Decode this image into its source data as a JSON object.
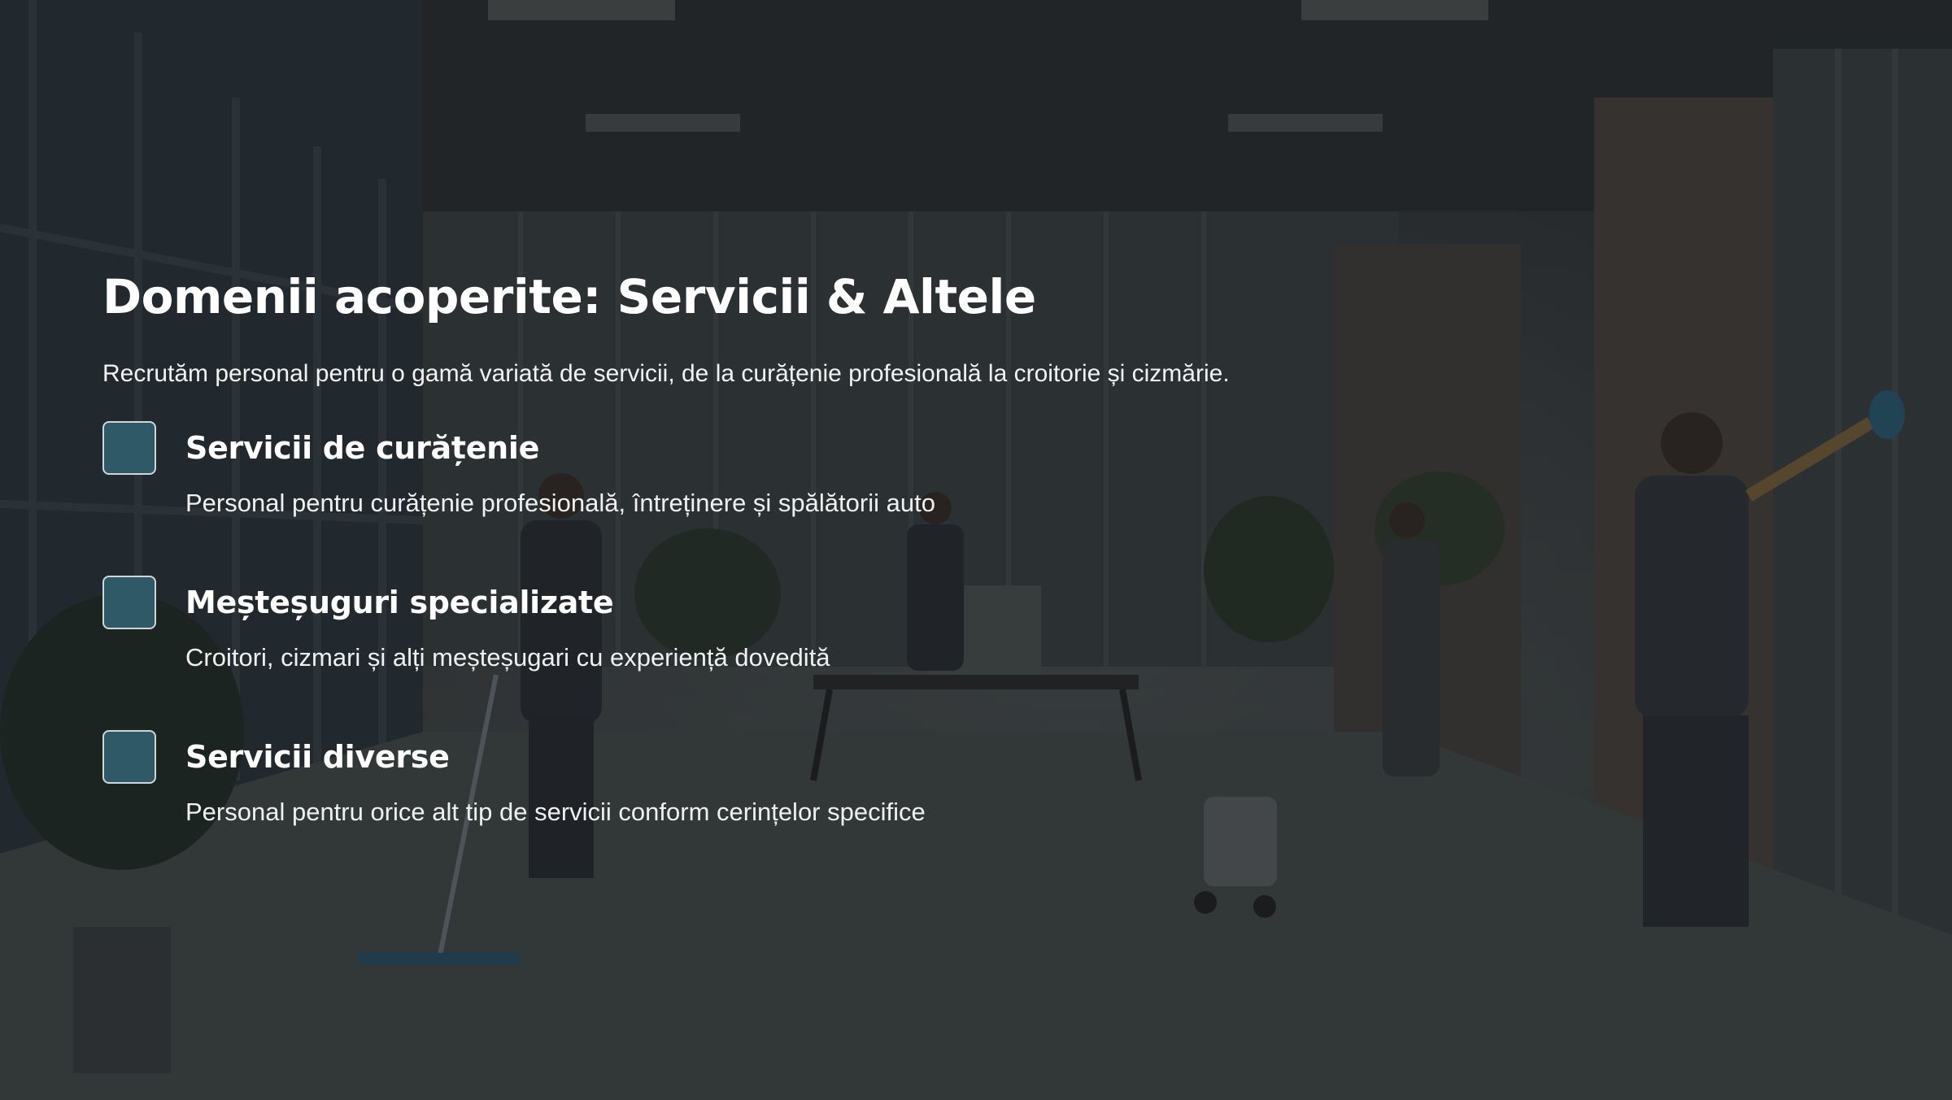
{
  "slide": {
    "title": "Domenii acoperite: Servicii & Altele",
    "subtitle": "Recrutăm personal pentru o gamă variată de servicii, de la curățenie profesională la croitorie și cizmărie.",
    "items": [
      {
        "title": "Servicii de curățenie",
        "description": "Personal pentru curățenie profesională, întreținere și spălătorii auto"
      },
      {
        "title": "Meșteșuguri specializate",
        "description": "Croitori, cizmari și alți meșteșugari cu experiență dovedită"
      },
      {
        "title": "Servicii diverse",
        "description": "Personal pentru orice alt tip de servicii conform cerințelor specifice"
      }
    ]
  },
  "colors": {
    "checkbox_fill": "#2f5966",
    "checkbox_border": "#cfd6d8",
    "text": "#ffffff"
  }
}
